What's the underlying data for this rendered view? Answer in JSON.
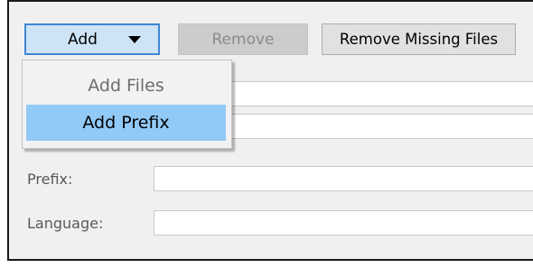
{
  "toolbar": {
    "add_label": "Add",
    "remove_label": "Remove",
    "remove_missing_label": "Remove Missing Files"
  },
  "dropdown": {
    "items": [
      {
        "label": "Add Files",
        "state": "disabled"
      },
      {
        "label": "Add Prefix",
        "state": "highlighted"
      }
    ]
  },
  "form": {
    "prefix_label": "Prefix:",
    "prefix_value": "",
    "language_label": "Language:",
    "language_value": ""
  },
  "icons": {
    "dropdown_arrow": "caret-down-icon"
  },
  "colors": {
    "highlight": "#91c9f7",
    "add_button_bg": "#cde4f7",
    "add_button_border": "#3f86d2"
  }
}
